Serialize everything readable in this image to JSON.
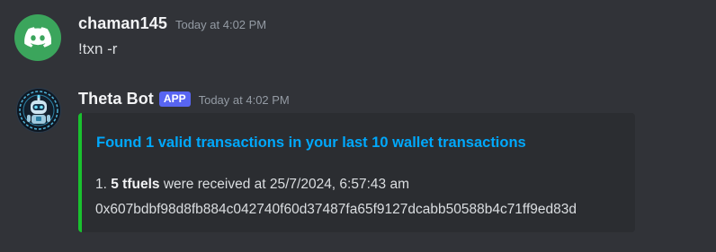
{
  "messages": [
    {
      "username": "chaman145",
      "timestamp": "Today at 4:02 PM",
      "content": "!txn -r",
      "avatar_icon": "discord-logo-icon",
      "avatar_color": "#3ba55c"
    },
    {
      "username": "Theta Bot",
      "badge": "APP",
      "timestamp": "Today at 4:02 PM",
      "avatar_icon": "robot-icon",
      "embed": {
        "accent_color": "#19c12e",
        "title_prefix": "Found ",
        "title_count": "1 valid",
        "title_suffix": " transactions in your last 10 wallet transactions",
        "item_number": "1.",
        "item_amount": "5 tfuels",
        "item_text": "were received at 25/7/2024, 6:57:43 am",
        "tx_hash": "0x607bdbf98d8fb884c042740f60d37487fa65f9127dcabb50588b4c71ff9ed83d"
      }
    }
  ],
  "colors": {
    "background": "#313338",
    "embed_background": "#2b2d31",
    "link_blue": "#00a8fc",
    "app_badge": "#5865f2"
  }
}
